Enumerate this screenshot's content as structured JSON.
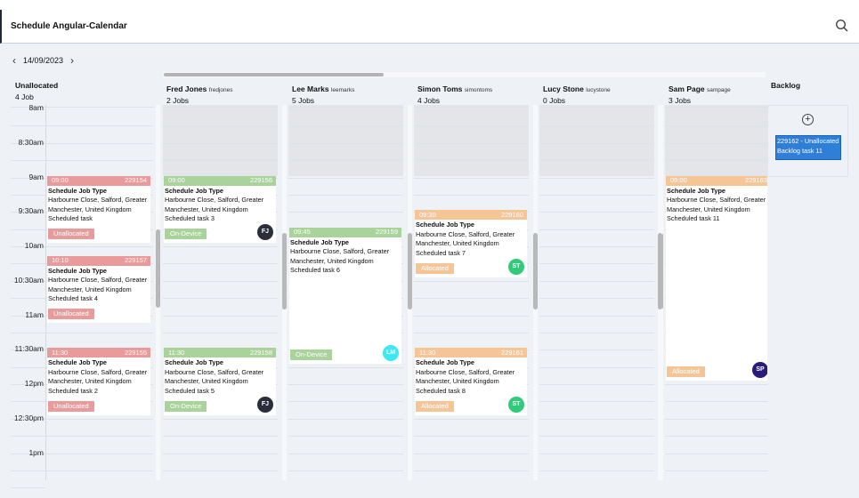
{
  "header": {
    "title": "Schedule Angular-Calendar",
    "search_icon": "search-icon"
  },
  "date_nav": {
    "date": "14/09/2023",
    "prev": "‹",
    "next": "›"
  },
  "colors": {
    "unallocated": "#e99a9a",
    "on_device": "#a9d39b",
    "allocated": "#f6c596",
    "backlog": "#2f7fd8"
  },
  "time_labels": [
    "8am",
    "8:30am",
    "9am",
    "9:30am",
    "10am",
    "10:30am",
    "11am",
    "11:30am",
    "12pm",
    "12:30pm",
    "1pm"
  ],
  "unallocated": {
    "title": "Unallocated",
    "count": "4 Job",
    "events": [
      {
        "start": "09:00",
        "hours": 1,
        "id": "229154",
        "type": "Schedule Job Type",
        "address": "Harbourne Close, Salford, Greater Manchester, United Kingdom",
        "task": "Scheduled task",
        "status": "Unallocated",
        "color": "#e99a9a"
      },
      {
        "start": "10:10",
        "hours": 1,
        "id": "229157",
        "type": "Schedule Job Type",
        "address": "Harbourne Close, Salford, Greater Manchester, United Kingdom",
        "task": "Scheduled task 4",
        "status": "Unallocated",
        "color": "#e99a9a"
      },
      {
        "start": "11:30",
        "hours": 1,
        "id": "229155",
        "type": "Schedule Job Type",
        "address": "Harbourne Close, Salford, Greater Manchester, United Kingdom",
        "task": "Scheduled task 2",
        "status": "Unallocated",
        "color": "#e99a9a"
      }
    ]
  },
  "resources": [
    {
      "name": "Fred Jones",
      "user": "fredjones",
      "jobs": "2 Jobs",
      "events": [
        {
          "start": "09:00",
          "hours": 1,
          "id": "229156",
          "type": "Schedule Job Type",
          "address": "Harbourne Close, Salford, Greater Manchester, United Kingdom",
          "task": "Scheduled task 3",
          "status": "On-Device",
          "color": "#a9d39b",
          "initials": "FJ",
          "avatar_color": "#2b2d3a"
        },
        {
          "start": "11:30",
          "hours": 1,
          "id": "229158",
          "type": "Schedule Job Type",
          "address": "Harbourne Close, Salford, Greater Manchester, United Kingdom",
          "task": "Scheduled task 5",
          "status": "On-Device",
          "color": "#a9d39b",
          "initials": "FJ",
          "avatar_color": "#2b2d3a"
        }
      ]
    },
    {
      "name": "Lee Marks",
      "user": "leemarks",
      "jobs": "5 Jobs",
      "events": [
        {
          "start": "09:45",
          "hours": 2,
          "id": "229159",
          "type": "Schedule Job Type",
          "address": "Harbourne Close, Salford, Greater Manchester, United Kingdom",
          "task": "Scheduled task 6",
          "status": "On-Device",
          "color": "#a9d39b",
          "initials": "LM",
          "avatar_color": "#3ee8f0"
        }
      ]
    },
    {
      "name": "Simon Toms",
      "user": "simontoms",
      "jobs": "4 Jobs",
      "events": [
        {
          "start": "09:30",
          "hours": 1,
          "id": "229160",
          "type": "Schedule Job Type",
          "address": "Harbourne Close, Salford, Greater Manchester, United Kingdom",
          "task": "Scheduled task 7",
          "status": "Allocated",
          "color": "#f6c596",
          "initials": "ST",
          "avatar_color": "#2ecc7a"
        },
        {
          "start": "11:30",
          "hours": 1,
          "id": "229161",
          "type": "Schedule Job Type",
          "address": "Harbourne Close, Salford, Greater Manchester, United Kingdom",
          "task": "Scheduled task 8",
          "status": "Allocated",
          "color": "#f6c596",
          "initials": "ST",
          "avatar_color": "#2ecc7a"
        }
      ]
    },
    {
      "name": "Lucy Stone",
      "user": "lucystone",
      "jobs": "0 Jobs",
      "events": []
    },
    {
      "name": "Sam Page",
      "user": "sampage",
      "jobs": "3 Jobs",
      "events": [
        {
          "start": "09:00",
          "hours": 3,
          "id": "229163",
          "type": "Schedule Job Type",
          "address": "Harbourne Close, Salford, Greater Manchester, United Kingdom",
          "task": "Scheduled task 11",
          "status": "Allocated",
          "color": "#f6c596",
          "initials": "SP",
          "avatar_color": "#2a1a7a"
        }
      ]
    }
  ],
  "backlog": {
    "title": "Backlog",
    "add_icon": "plus-circle-icon",
    "items": [
      {
        "text": "229162 - Unallocated Backlog task 11"
      }
    ]
  }
}
